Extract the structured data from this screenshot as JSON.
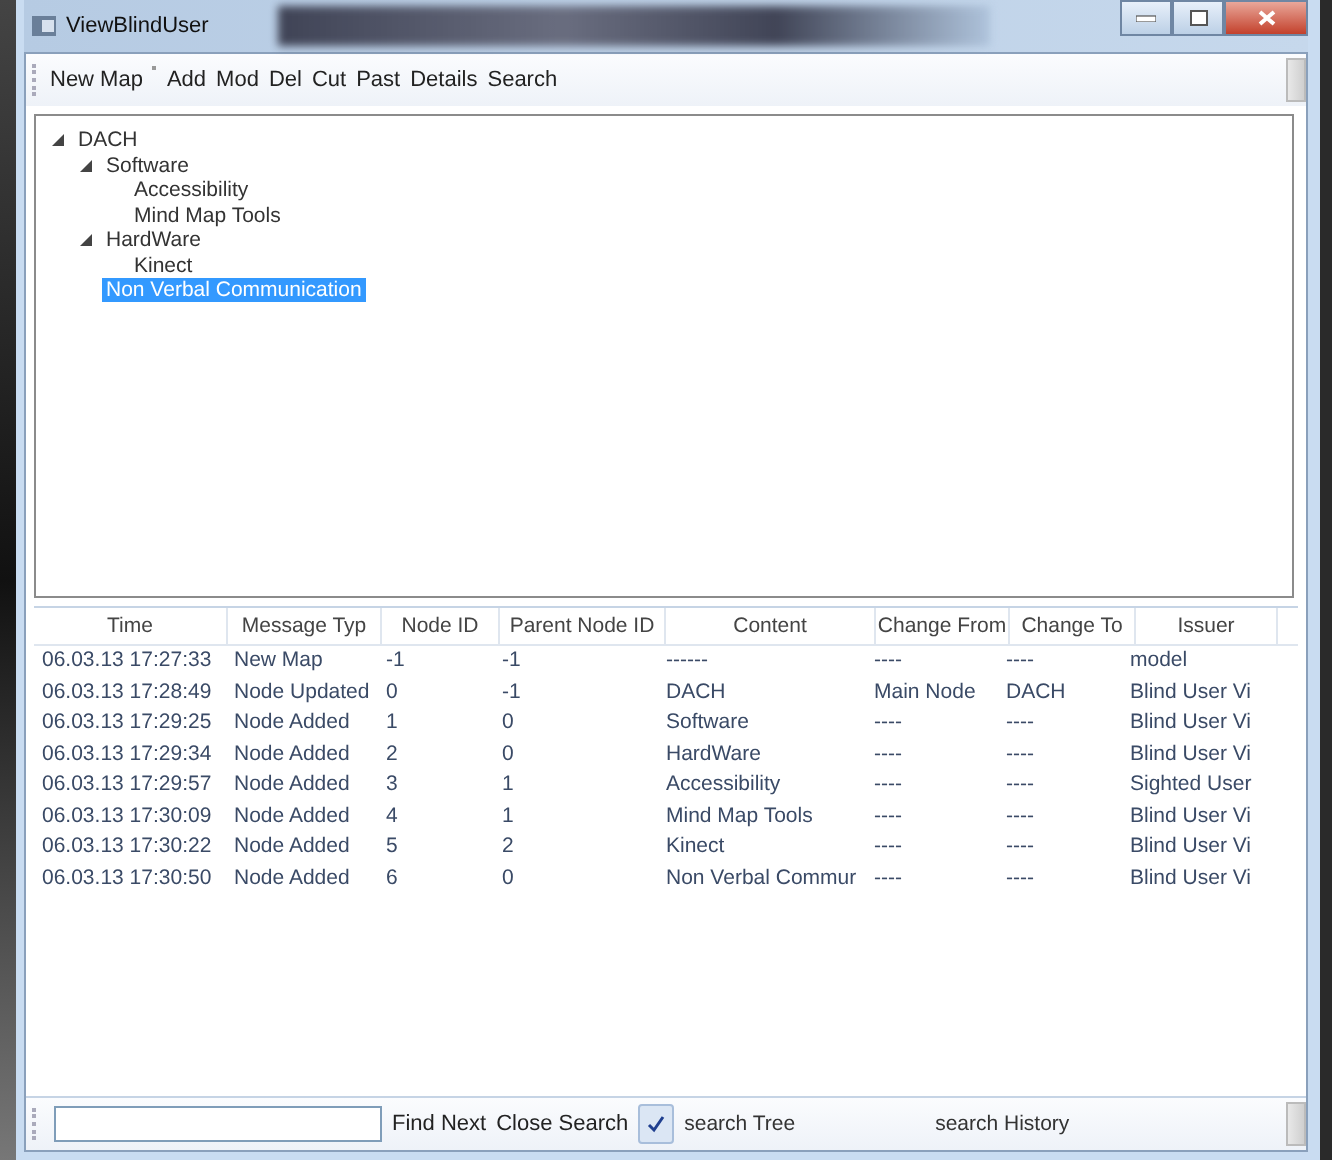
{
  "window": {
    "title": "ViewBlindUser"
  },
  "toolbar": {
    "items": [
      {
        "label": "New Map"
      },
      {
        "label": "Add"
      },
      {
        "label": "Mod"
      },
      {
        "label": "Del"
      },
      {
        "label": "Cut"
      },
      {
        "label": "Past"
      },
      {
        "label": "Details"
      },
      {
        "label": "Search"
      }
    ]
  },
  "tree": [
    {
      "label": "DACH",
      "expanded": true,
      "selected": false,
      "children": [
        {
          "label": "Software",
          "expanded": true,
          "selected": false,
          "children": [
            {
              "label": "Accessibility",
              "selected": false
            },
            {
              "label": "Mind Map Tools",
              "selected": false
            }
          ]
        },
        {
          "label": "HardWare",
          "expanded": true,
          "selected": false,
          "children": [
            {
              "label": "Kinect",
              "selected": false
            }
          ]
        },
        {
          "label": "Non Verbal Communication",
          "selected": true
        }
      ]
    }
  ],
  "table": {
    "columns": [
      "Time",
      "Message Typ",
      "Node ID",
      "Parent Node ID",
      "Content",
      "Change From",
      "Change To",
      "Issuer"
    ],
    "rows": [
      [
        "06.03.13 17:27:33",
        "New Map",
        "-1",
        "-1",
        "------",
        "----",
        "----",
        "model"
      ],
      [
        "06.03.13 17:28:49",
        "Node Updated",
        "0",
        "-1",
        "DACH",
        "Main Node",
        "DACH",
        "Blind User Vi"
      ],
      [
        "06.03.13 17:29:25",
        "Node Added",
        "1",
        "0",
        "Software",
        "----",
        "----",
        "Blind User Vi"
      ],
      [
        "06.03.13 17:29:34",
        "Node Added",
        "2",
        "0",
        "HardWare",
        "----",
        "----",
        "Blind User Vi"
      ],
      [
        "06.03.13 17:29:57",
        "Node Added",
        "3",
        "1",
        "Accessibility",
        "----",
        "----",
        "Sighted User"
      ],
      [
        "06.03.13 17:30:09",
        "Node Added",
        "4",
        "1",
        "Mind Map Tools",
        "----",
        "----",
        "Blind User Vi"
      ],
      [
        "06.03.13 17:30:22",
        "Node Added",
        "5",
        "2",
        "Kinect",
        "----",
        "----",
        "Blind User Vi"
      ],
      [
        "06.03.13 17:30:50",
        "Node Added",
        "6",
        "0",
        "Non Verbal Commur",
        "----",
        "----",
        "Blind User Vi"
      ]
    ]
  },
  "search_bar": {
    "buttons": [
      "Find Next",
      "Close Search"
    ],
    "options": [
      {
        "label": "search Tree",
        "checked": true
      },
      {
        "label": "search History",
        "checked": false
      }
    ]
  }
}
